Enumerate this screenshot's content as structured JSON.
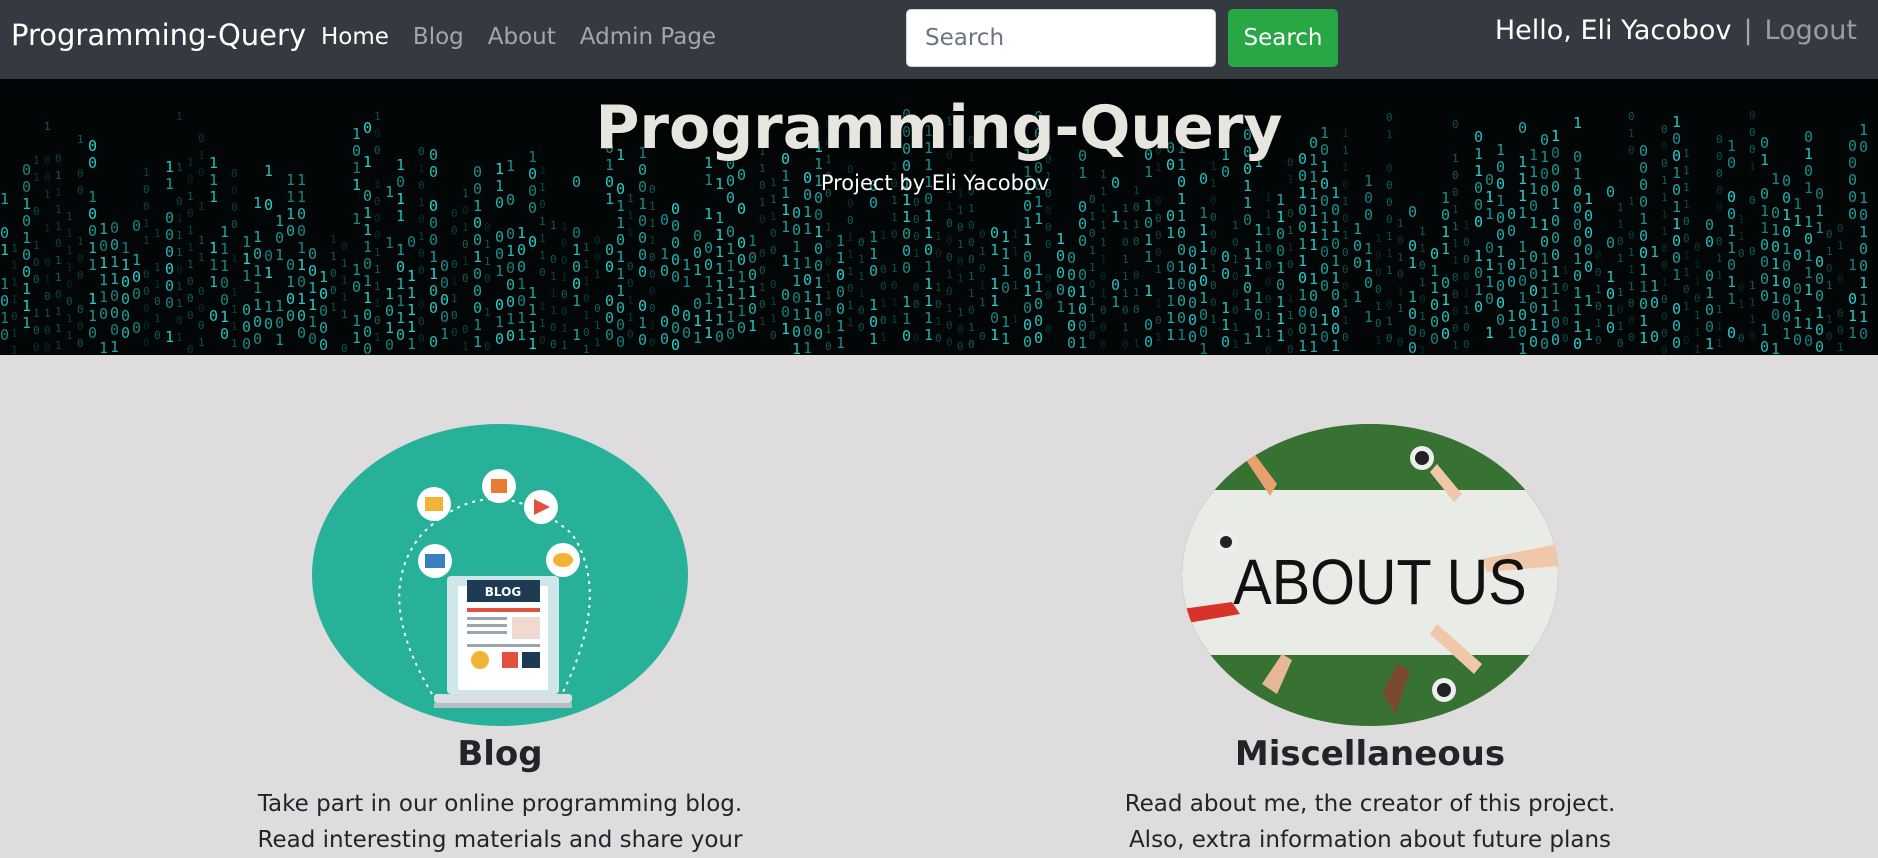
{
  "navbar": {
    "brand": "Programming-Query",
    "links": [
      {
        "label": "Home",
        "active": true
      },
      {
        "label": "Blog",
        "active": false
      },
      {
        "label": "About",
        "active": false
      },
      {
        "label": "Admin Page",
        "active": false
      }
    ],
    "search": {
      "placeholder": "Search",
      "button_label": "Search"
    },
    "user": {
      "greeting": "Hello, Eli Yacobov",
      "separator": "|",
      "logout_label": "Logout"
    }
  },
  "hero": {
    "title": "Programming-Query",
    "subtitle": "Project by Eli Yacobov"
  },
  "cards": [
    {
      "title": "Blog",
      "lines": [
        "Take part in our online programming blog.",
        "Read interesting materials and share your"
      ],
      "image_text": "BLOG"
    },
    {
      "title": "Miscellaneous",
      "lines": [
        "Read about me, the creator of this project.",
        "Also, extra information about future plans"
      ],
      "image_text": "ABOUT US"
    }
  ],
  "colors": {
    "navbar": "#343a40",
    "search_button": "#28a745",
    "page_background": "#dedcdd",
    "matrix_digits": "#2ad6d2",
    "blog_circle": "#26b198"
  },
  "icons": {
    "blog_image": "blog-laptop-illustration",
    "about_image": "about-us-banner-photo"
  }
}
